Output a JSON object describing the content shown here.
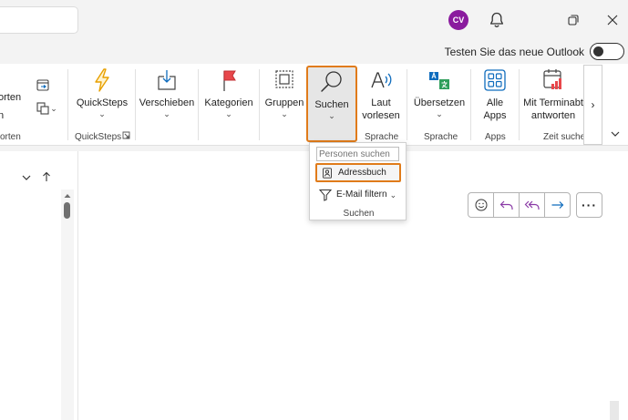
{
  "titlebar": {
    "avatar_initials": "CV"
  },
  "toggle": {
    "label": "Testen Sie das neue Outlook",
    "state": "off"
  },
  "ribbon": {
    "partial_left": {
      "line1": "orten",
      "line2": "n",
      "group": "orten"
    },
    "quicksteps": {
      "label": "QuickSteps",
      "group": "QuickSteps"
    },
    "verschieben": {
      "label": "Verschieben"
    },
    "kategorien": {
      "label": "Kategorien"
    },
    "gruppen": {
      "label": "Gruppen"
    },
    "suchen": {
      "label": "Suchen"
    },
    "laut": {
      "line1": "Laut",
      "line2": "vorlesen"
    },
    "sprache_group": "Sprache",
    "uebersetzen": {
      "label": "Übersetzen",
      "group": "Sprache"
    },
    "apps": {
      "line1": "Alle",
      "line2": "Apps",
      "group": "Apps"
    },
    "termin": {
      "line1": "Mit Terminabt",
      "line2": "antworten",
      "group": "Zeit sucher"
    }
  },
  "dropdown": {
    "people_placeholder": "Personen suchen",
    "adressbuch": "Adressbuch",
    "email_filter": "E-Mail filtern",
    "group_label": "Suchen"
  },
  "colors": {
    "highlight": "#e07b1a",
    "avatar": "#8a1b9e",
    "accent_blue": "#0f6cbd"
  }
}
